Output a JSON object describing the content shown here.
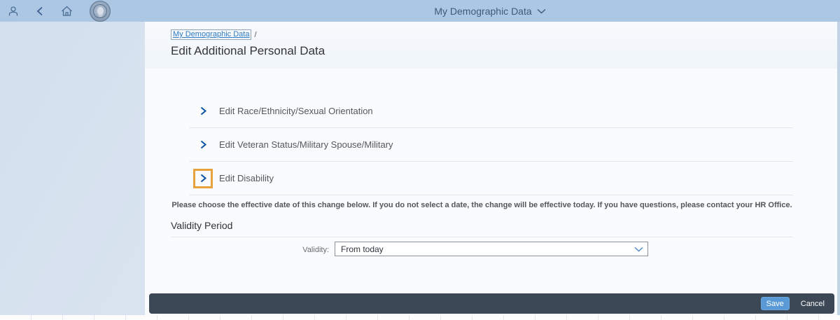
{
  "shell": {
    "title": "My Demographic Data",
    "icons": [
      "person",
      "back",
      "home",
      "state-seal-logo",
      "chevron-down"
    ]
  },
  "breadcrumb": {
    "link": "My Demographic Data",
    "separator": "/"
  },
  "page": {
    "title": "Edit Additional Personal Data"
  },
  "sections": [
    {
      "label": "Edit Race/Ethnicity/Sexual Orientation",
      "highlighted": false
    },
    {
      "label": "Edit Veteran Status/Military Spouse/Military",
      "highlighted": false
    },
    {
      "label": "Edit Disability",
      "highlighted": true
    }
  ],
  "notice": {
    "text": "Please choose the effective date of this change below. If you do not select a date, the change will be effective today. If you have questions, please contact your HR Office."
  },
  "validity": {
    "heading": "Validity Period",
    "label": "Validity:",
    "value": "From today"
  },
  "footer": {
    "save": "Save",
    "cancel": "Cancel"
  },
  "colors": {
    "shell_bar": "#abc7e3",
    "shell_title_text": "#3d5a7a",
    "link_blue": "#2f7bc4",
    "chevron_blue": "#0854a0",
    "highlight_orange": "#e8a23b",
    "footer_bar": "#3c4856",
    "save_button": "#5899d6",
    "text_dark": "#32363a"
  }
}
